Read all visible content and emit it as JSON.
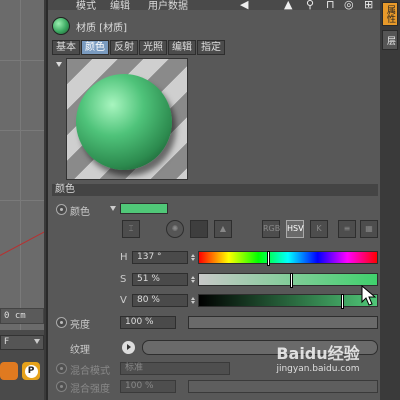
{
  "menubar": {
    "items": [
      "模式",
      "编辑",
      "用户数据"
    ]
  },
  "viewport": {
    "coord_readout": "0 cm",
    "f_field": "F"
  },
  "material": {
    "title": "材质 [材质]",
    "tabs": [
      {
        "label": "基本",
        "active": false
      },
      {
        "label": "颜色",
        "active": true
      },
      {
        "label": "反射",
        "active": false
      },
      {
        "label": "光照",
        "active": false
      },
      {
        "label": "编辑",
        "active": false
      },
      {
        "label": "指定",
        "active": false
      }
    ],
    "swatch_color": "#50c878"
  },
  "color_section": {
    "title": "颜色",
    "color_label": "颜色",
    "tool_buttons": [
      "RGB",
      "HSV",
      "K"
    ],
    "active_mode": "HSV",
    "hsv": [
      {
        "key": "H",
        "value": "137 °",
        "fraction": 0.38
      },
      {
        "key": "S",
        "value": "51 %",
        "fraction": 0.51
      },
      {
        "key": "V",
        "value": "80 %",
        "fraction": 0.8
      }
    ],
    "brightness_label": "亮度",
    "brightness_value": "100 %",
    "texture_label": "纹理",
    "blend_mode_label": "混合模式",
    "blend_mode_value": "标准",
    "blend_strength_label": "混合强度",
    "blend_strength_value": "100 %"
  },
  "right_strip": {
    "tab_active": "属性",
    "tab_2": "层"
  },
  "watermark": {
    "brand": "Baidu经验",
    "url": "jingyan.baidu.com"
  }
}
